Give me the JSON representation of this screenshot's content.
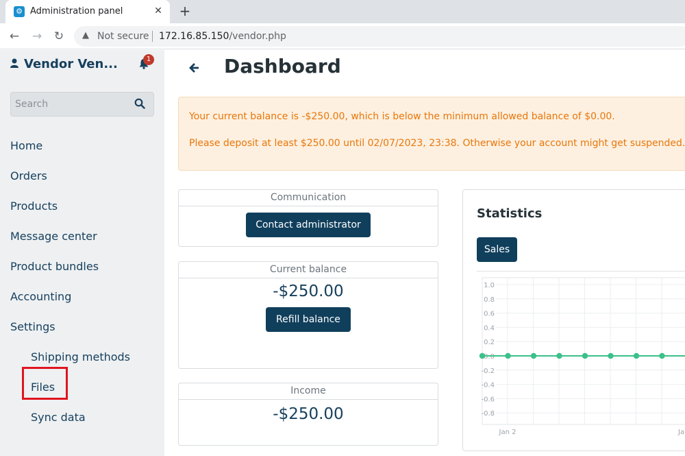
{
  "browser": {
    "tab_title": "Administration panel",
    "tab_close": "✕",
    "new_tab": "+",
    "security_label": "Not secure",
    "url_host": "172.16.85.150",
    "url_path": "/vendor.php"
  },
  "sidebar": {
    "user_name": "Vendor Ven...",
    "notification_count": "1",
    "search_placeholder": "Search",
    "items": [
      {
        "label": "Home"
      },
      {
        "label": "Orders"
      },
      {
        "label": "Products"
      },
      {
        "label": "Message center"
      },
      {
        "label": "Product bundles"
      },
      {
        "label": "Accounting"
      },
      {
        "label": "Settings"
      }
    ],
    "sub_items": [
      {
        "label": "Shipping methods"
      },
      {
        "label": "Files"
      },
      {
        "label": "Sync data"
      }
    ]
  },
  "main": {
    "title": "Dashboard",
    "alert": {
      "line1": "Your current balance is -$250.00, which is below the minimum allowed balance of $0.00.",
      "line2": "Please deposit at least $250.00 until 02/07/2023, 23:38. Otherwise your account might get suspended."
    },
    "communication": {
      "heading": "Communication",
      "button": "Contact administrator"
    },
    "balance": {
      "heading": "Current balance",
      "amount": "-$250.00",
      "button": "Refill balance"
    },
    "income": {
      "heading": "Income",
      "amount": "-$250.00"
    },
    "statistics": {
      "title": "Statistics",
      "tab": "Sales"
    }
  },
  "colors": {
    "primary": "#103f5c",
    "alert_text": "#e8770b",
    "alert_bg": "#fdf0e0",
    "series": "#3cc08a",
    "badge": "#c0392b",
    "highlight_box": "#e0141e"
  },
  "chart_data": {
    "type": "line",
    "y_ticks": [
      "1.0",
      "0.8",
      "0.6",
      "0.4",
      "0.2",
      "0.0",
      "-0.2",
      "-0.4",
      "-0.6",
      "-0.8"
    ],
    "x_tick_labels": [
      "Jan 2",
      "Jan"
    ],
    "ylim": [
      -0.9,
      1.05
    ],
    "points": [
      0,
      0,
      0,
      0,
      0,
      0,
      0,
      0,
      0,
      0
    ],
    "grid": true
  }
}
